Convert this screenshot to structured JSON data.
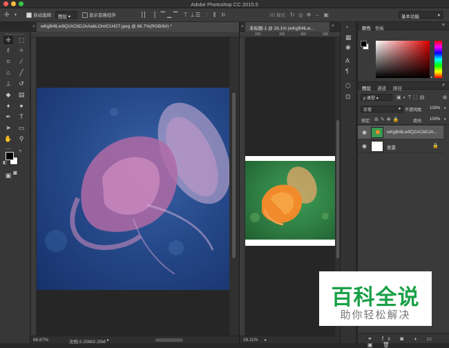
{
  "app": {
    "title": "Adobe Photoshop CC 2015.5"
  },
  "titlebar": {
    "dots": [
      "#fc605c",
      "#fdbc40",
      "#34c84a"
    ]
  },
  "options": {
    "auto_select_label": "自动选择:",
    "auto_select_value": "图层",
    "show_transform_label": "显示变换控件",
    "mode3d_label": "3D 模式:",
    "workspace_value": "基本功能"
  },
  "doc1": {
    "tab_label": "wKgB4lLw9Q2ACbDJAAabLOmICU427.jpeg @ 66.7%(RGB/8#) *",
    "zoom": "66.67%",
    "file_info": "文档:2.25M/2.25M"
  },
  "doc2": {
    "tab_label": "未标题-1 @ 26.1% (wKgB4lLw...",
    "zoom": "26.11%",
    "ruler_labels": [
      "200",
      "300",
      "400",
      "500"
    ]
  },
  "color_panel": {
    "tabs": [
      "颜色",
      "色板"
    ]
  },
  "layers_panel": {
    "tabs": [
      "图层",
      "通道",
      "路径"
    ],
    "filter_label": "ρ 类型",
    "blend_mode": "正常",
    "opacity_label": "不透明度:",
    "opacity_value": "100%",
    "lock_label": "锁定:",
    "fill_label": "填充:",
    "fill_value": "100%",
    "layers": [
      {
        "name": "wKgB4lLw9Q2ACbDJA...",
        "selected": true
      },
      {
        "name": "背景",
        "selected": false
      }
    ]
  },
  "watermark": {
    "title": "百科全说",
    "subtitle": "助你轻松解决"
  }
}
